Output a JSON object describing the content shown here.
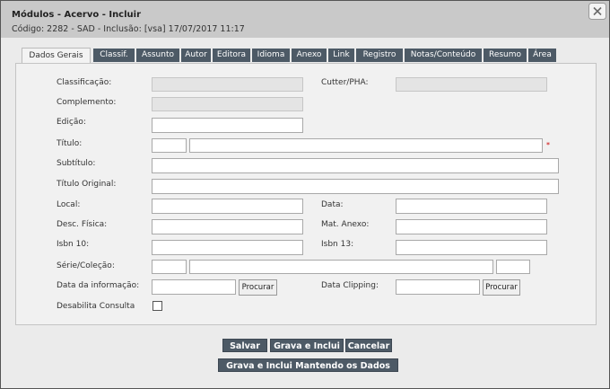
{
  "window": {
    "title": "Módulos - Acervo - Incluir",
    "subtitle": "Código: 2282 - SAD - Inclusão: [vsa] 17/07/2017 11:17"
  },
  "tabs": [
    "Dados Gerais",
    "Classif.",
    "Assunto",
    "Autor",
    "Editora",
    "Idioma",
    "Anexo",
    "Link",
    "Registro",
    "Notas/Conteúdo",
    "Resumo",
    "Área"
  ],
  "form": {
    "classificacao": "Classificação:",
    "cutter": "Cutter/PHA:",
    "complemento": "Complemento:",
    "edicao": "Edição:",
    "titulo": "Título:",
    "subtitulo": "Subtítulo:",
    "titulo_original": "Título Original:",
    "local": "Local:",
    "data": "Data:",
    "desc_fisica": "Desc. Física:",
    "mat_anexo": "Mat. Anexo:",
    "isbn10": "Isbn 10:",
    "isbn13": "Isbn 13:",
    "serie_colecao": "Série/Coleção:",
    "data_informacao": "Data da informação:",
    "data_clipping": "Data Clipping:",
    "desabilita_consulta": "Desabilita Consulta",
    "required_mark": "*",
    "procurar": "Procurar"
  },
  "buttons": {
    "salvar": "Salvar",
    "grava_inclui": "Grava e Inclui",
    "cancelar": "Cancelar",
    "grava_inclui_mantendo": "Grava e Inclui Mantendo os Dados"
  },
  "colors": {
    "tab_bg": "#4d5a66",
    "titlebar": "#c9c9c9",
    "panel": "#f1f1f1",
    "required": "#cc0000"
  }
}
